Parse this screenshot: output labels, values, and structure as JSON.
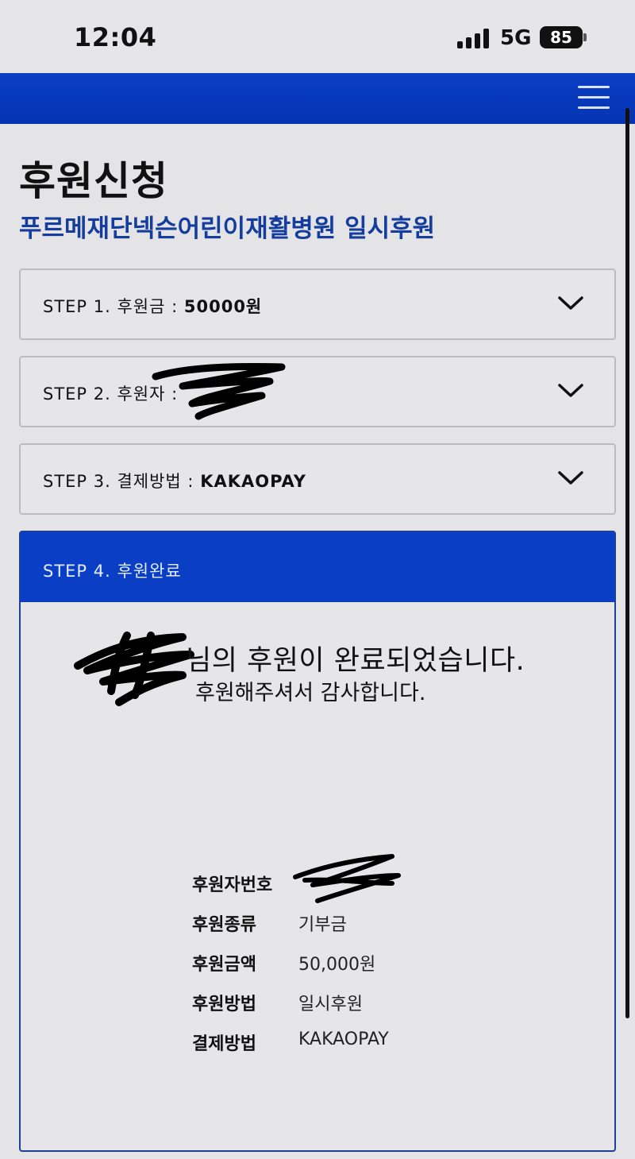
{
  "status_bar": {
    "time": "12:04",
    "network": "5G",
    "battery": "85"
  },
  "nav": {
    "menu_icon": "hamburger-menu-icon",
    "bar_color": "#0a3ec4"
  },
  "page": {
    "title": "후원신청",
    "subtitle": "푸르메재단넥슨어린이재활병원 일시후원"
  },
  "steps": [
    {
      "prefix": "STEP 1. 후원금 : ",
      "value": "50000원"
    },
    {
      "prefix": "STEP 2. 후원자 : ",
      "value": ""
    },
    {
      "prefix": "STEP 3. 결제방법 : ",
      "value": "KAKAOPAY"
    },
    {
      "prefix": "STEP 4. 후원완료",
      "value": ""
    }
  ],
  "completion": {
    "message": "님의 후원이 완료되었습니다.",
    "thanks": "후원해주셔서 감사합니다."
  },
  "details": [
    {
      "key": "후원자번호",
      "value": ""
    },
    {
      "key": "후원종류",
      "value": "기부금"
    },
    {
      "key": "후원금액",
      "value": "50,000원"
    },
    {
      "key": "후원방법",
      "value": "일시후원"
    },
    {
      "key": "결제방법",
      "value": "KAKAOPAY"
    }
  ]
}
